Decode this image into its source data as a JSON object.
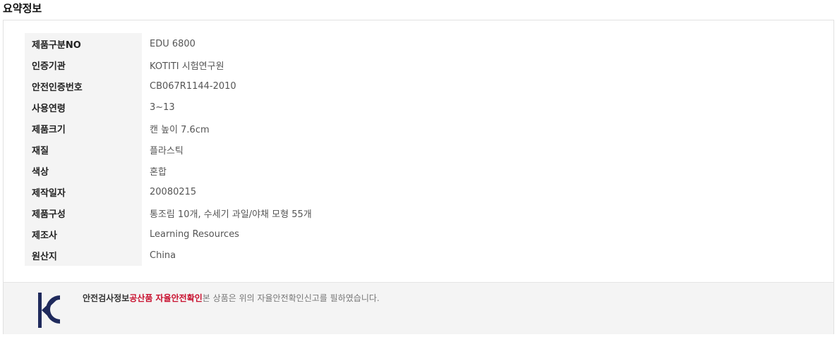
{
  "section_title": "요약정보",
  "specs": [
    {
      "key": "제품구분NO",
      "value": "EDU 6800"
    },
    {
      "key": "인증기관",
      "value": "KOTITI 시험연구원"
    },
    {
      "key": "안전인증번호",
      "value": "CB067R1144-2010"
    },
    {
      "key": "사용연령",
      "value": "3~13"
    },
    {
      "key": "제품크기",
      "value": "캔 높이 7.6cm"
    },
    {
      "key": "재질",
      "value": "플라스틱"
    },
    {
      "key": "색상",
      "value": "혼합"
    },
    {
      "key": "제작일자",
      "value": "20080215"
    },
    {
      "key": "제품구성",
      "value": "통조림 10개, 수세기 과일/야채 모형 55개"
    },
    {
      "key": "제조사",
      "value": "Learning Resources"
    },
    {
      "key": "원산지",
      "value": "China"
    }
  ],
  "kc": {
    "logo_icon": "kc-mark-icon",
    "label": "안전검사정보",
    "highlight": "공산품 자율안전확인",
    "text": "본 상품은 위의 자율안전확인신고를 필하였습니다.",
    "highlight_color": "#c8102e"
  }
}
